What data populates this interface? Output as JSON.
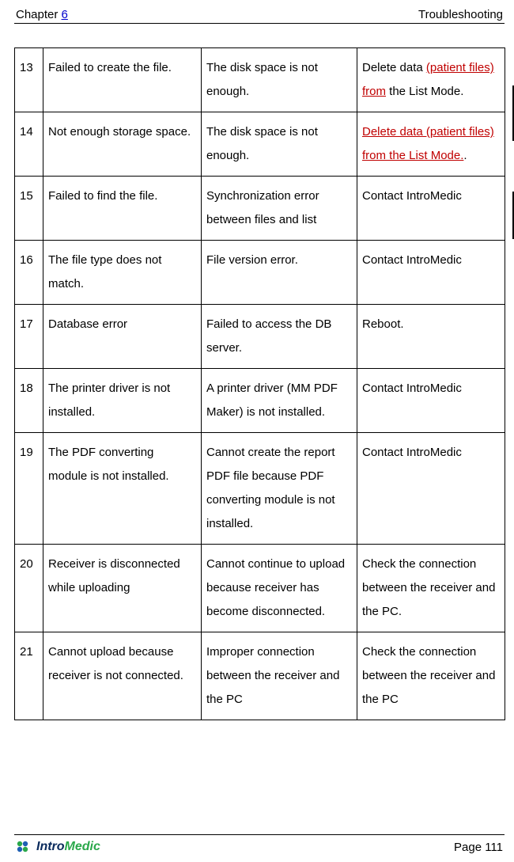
{
  "header": {
    "chapter_label": "Chapter",
    "chapter_number": "6",
    "section": "Troubleshooting"
  },
  "rows": [
    {
      "num": "13",
      "desc": "Failed to create the file.",
      "cause": "The disk space is not enough.",
      "action_pre": "Delete data ",
      "action_rev": "(patient files) from",
      "action_post": " the List Mode."
    },
    {
      "num": "14",
      "desc": "Not enough storage space.",
      "cause": "The disk space is not enough.",
      "action_pre": "",
      "action_rev": "Delete data (patient files) from the List Mode.",
      "action_post": "."
    },
    {
      "num": "15",
      "desc": "Failed to find the file.",
      "cause": "Synchronization error between files and list",
      "action_pre": "Contact IntroMedic",
      "action_rev": "",
      "action_post": ""
    },
    {
      "num": "16",
      "desc": "The file type does not match.",
      "cause": "File version error.",
      "action_pre": "Contact IntroMedic",
      "action_rev": "",
      "action_post": ""
    },
    {
      "num": "17",
      "desc": "Database error",
      "cause": "Failed to access the DB server.",
      "action_pre": "Reboot.",
      "action_rev": "",
      "action_post": ""
    },
    {
      "num": "18",
      "desc": "The printer driver is not installed.",
      "cause": "A printer driver (MM PDF Maker) is not installed.",
      "action_pre": "Contact IntroMedic",
      "action_rev": "",
      "action_post": ""
    },
    {
      "num": "19",
      "desc": "The PDF converting module is not installed.",
      "cause": "Cannot create the report PDF file because PDF converting module is not installed.",
      "action_pre": "Contact IntroMedic",
      "action_rev": "",
      "action_post": ""
    },
    {
      "num": "20",
      "desc": "Receiver is disconnected while uploading",
      "cause": "Cannot continue to upload because receiver has become disconnected.",
      "action_pre": "Check the connection between the receiver and the PC.",
      "action_rev": "",
      "action_post": ""
    },
    {
      "num": "21",
      "desc": "Cannot upload because receiver is not connected.",
      "cause": "Improper connection between the receiver and the PC",
      "action_pre": "Check the connection between the receiver and the PC",
      "action_rev": "",
      "action_post": ""
    }
  ],
  "footer": {
    "brand_intro": "Intro",
    "brand_medic": "Medic",
    "page": "Page 111"
  }
}
